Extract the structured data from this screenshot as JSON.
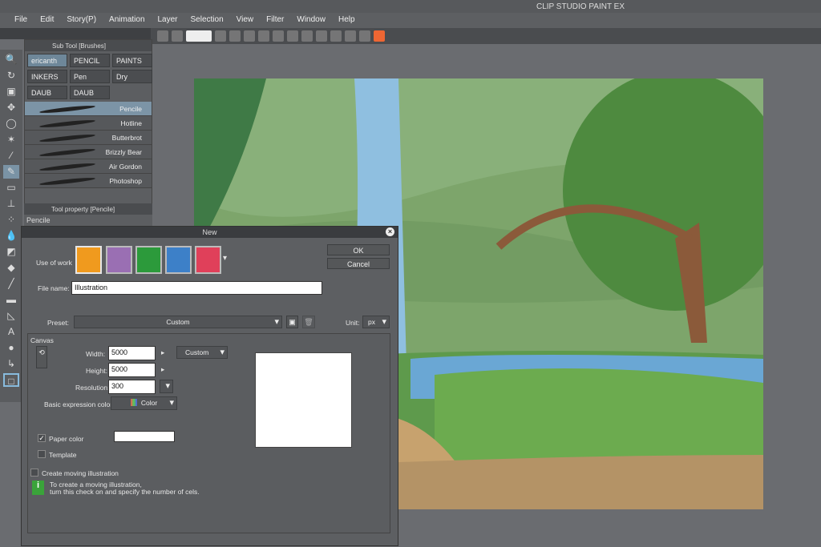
{
  "app": {
    "title": "CLIP STUDIO PAINT EX"
  },
  "menu": [
    "File",
    "Edit",
    "Story(P)",
    "Animation",
    "Layer",
    "Selection",
    "View",
    "Filter",
    "Window",
    "Help"
  ],
  "subtool": {
    "title": "Sub Tool [Brushes]",
    "groups": [
      "ericanth",
      "PENCIL",
      "PAINTS",
      "INKERS",
      "Pen",
      "Dry",
      "DAUB",
      "DAUB"
    ],
    "brushes": [
      "Pencile",
      "Hotline",
      "Butterbrot",
      "Brizzly Bear",
      "Air Gordon",
      "Photoshop"
    ],
    "selected": "Pencile"
  },
  "toolprop": {
    "title": "Tool property [Pencile]",
    "name": "Pencile"
  },
  "dialog": {
    "title": "New",
    "ok": "OK",
    "cancel": "Cancel",
    "use_of_work_label": "Use of work",
    "file_name_label": "File name:",
    "file_name": "Illustration",
    "preset_label": "Preset:",
    "preset": "Custom",
    "unit_label": "Unit:",
    "unit": "px",
    "canvas_label": "Canvas",
    "width_label": "Width:",
    "width": "5000",
    "height_label": "Height:",
    "height": "5000",
    "size_preset": "Custom",
    "resolution_label": "Resolution:",
    "resolution": "300",
    "color_label": "Basic expression color:",
    "color": "Color",
    "paper_color_label": "Paper color",
    "paper_color_checked": true,
    "template_label": "Template",
    "template_checked": false,
    "moving_label": "Create moving illustration",
    "moving_checked": false,
    "info": "To create a moving illustration,",
    "info2": "turn this check on and specify the number of cels."
  }
}
